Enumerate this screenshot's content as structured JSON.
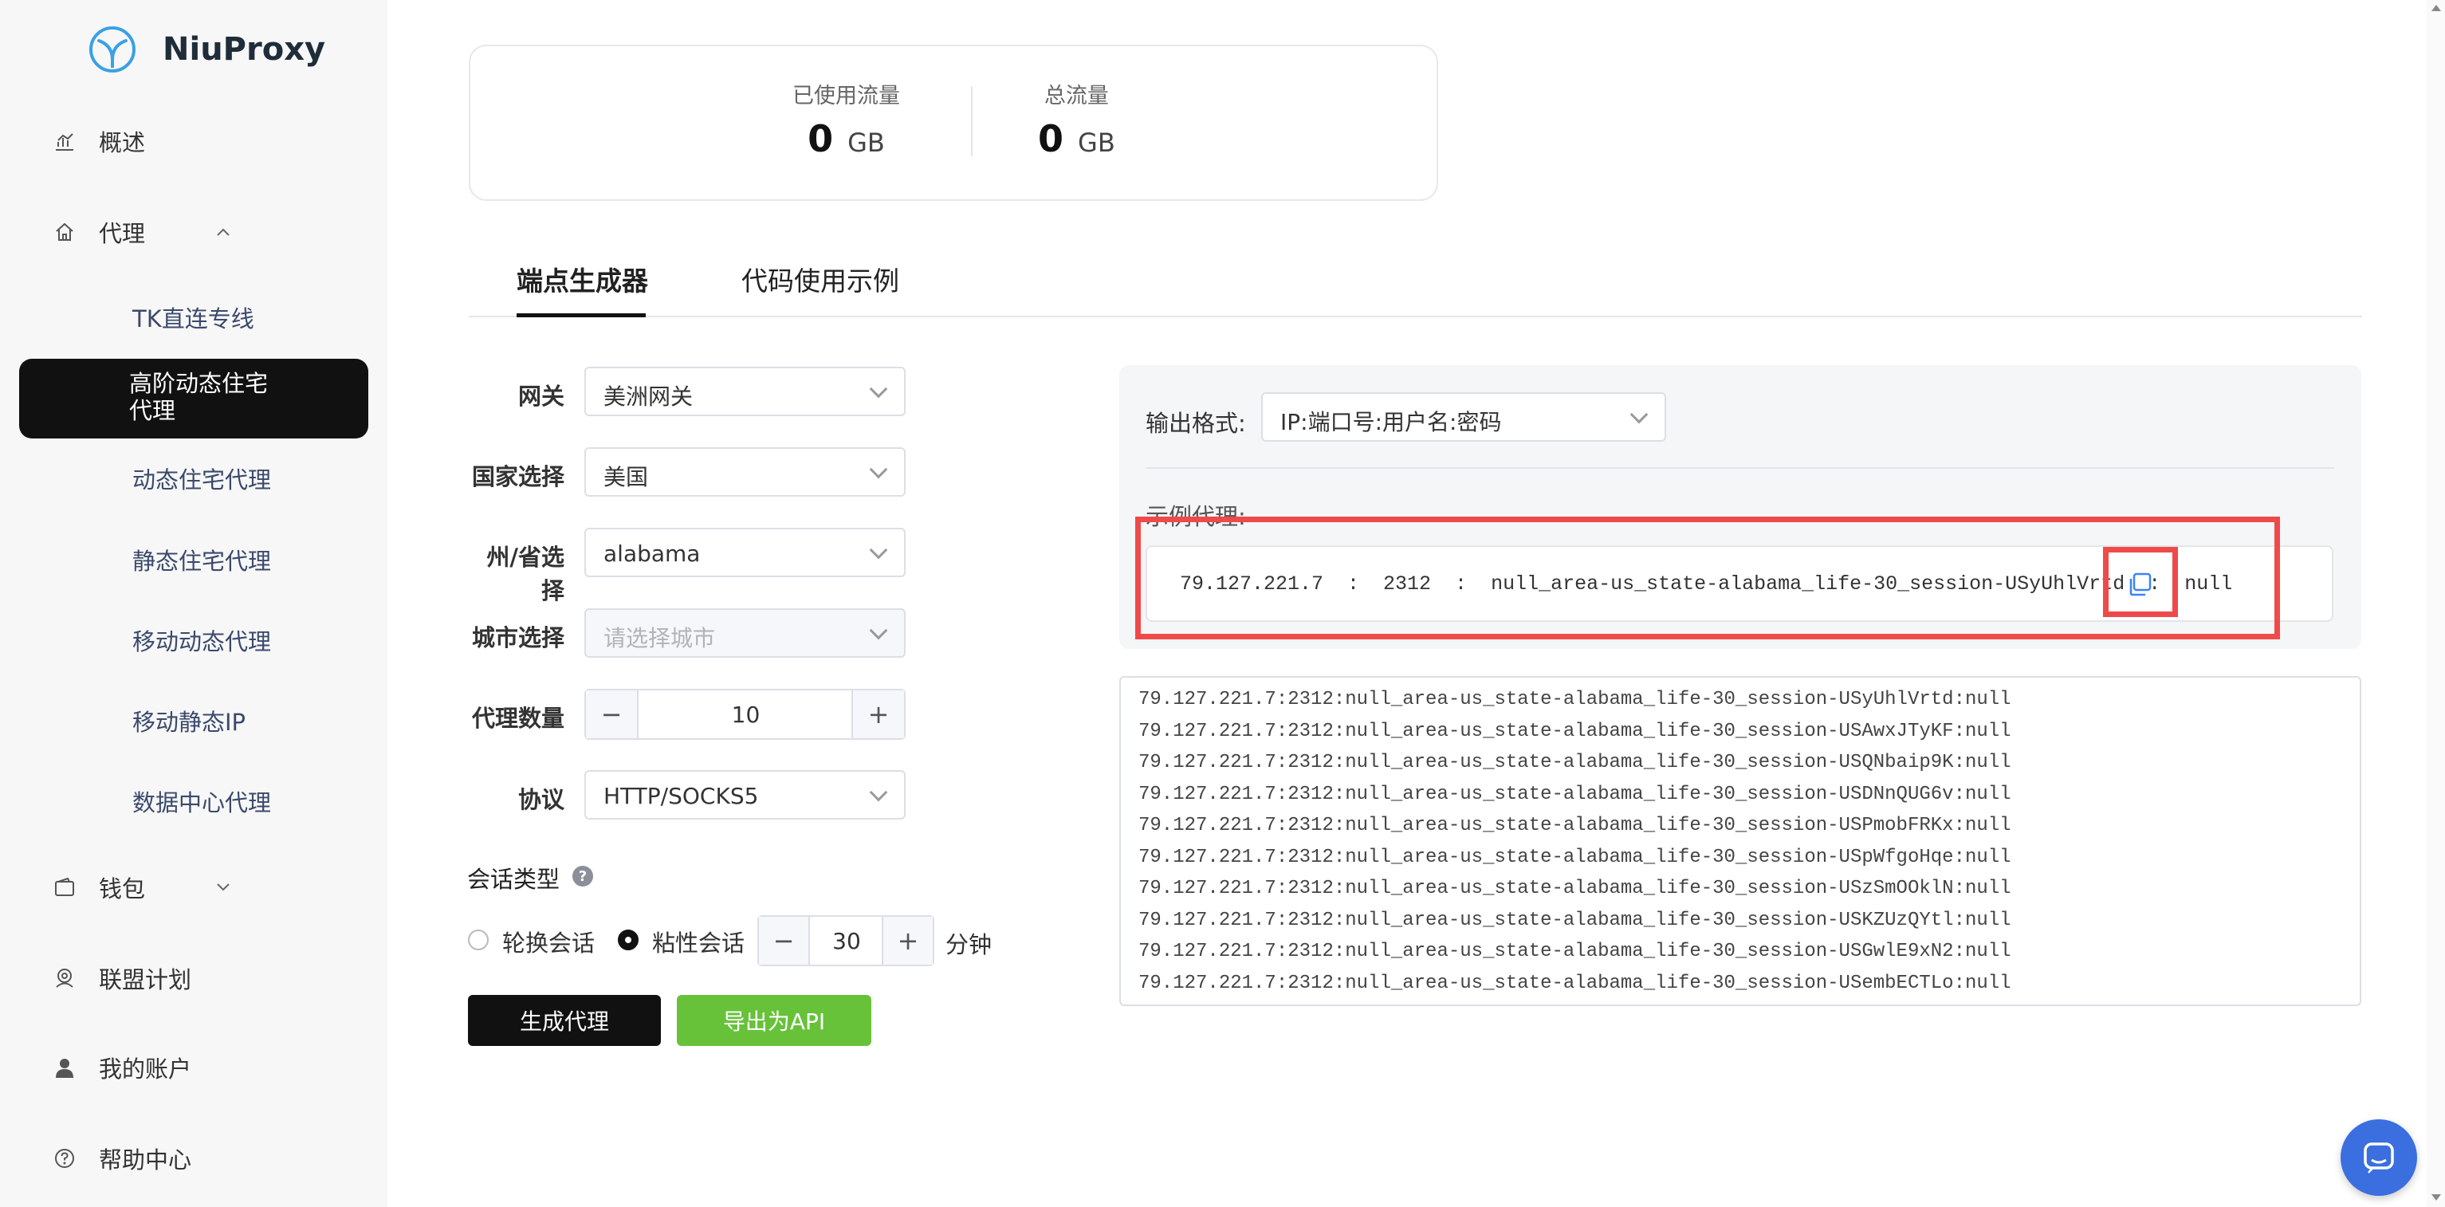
{
  "brand": {
    "name": "NiuProxy"
  },
  "sidebar": {
    "items": [
      {
        "label": "概述",
        "icon": "chart-icon"
      },
      {
        "label": "代理",
        "icon": "home-icon",
        "expanded": true
      },
      {
        "label": "钱包",
        "icon": "wallet-icon",
        "expanded": false
      },
      {
        "label": "联盟计划",
        "icon": "affiliate-icon"
      },
      {
        "label": "我的账户",
        "icon": "user-icon"
      },
      {
        "label": "帮助中心",
        "icon": "help-circle-icon"
      }
    ],
    "proxy_sub": [
      "TK直连专线",
      "高阶动态住宅代理",
      "动态住宅代理",
      "静态住宅代理",
      "移动动态代理",
      "移动静态IP",
      "数据中心代理"
    ],
    "active_sub_line1": "高阶动态住宅",
    "active_sub_line2": "代理"
  },
  "stats": {
    "used_label": "已使用流量",
    "used_value": "0",
    "used_unit": "GB",
    "total_label": "总流量",
    "total_value": "0",
    "total_unit": "GB"
  },
  "tabs": [
    {
      "label": "端点生成器",
      "active": true
    },
    {
      "label": "代码使用示例",
      "active": false
    }
  ],
  "form": {
    "gateway_label": "网关",
    "gateway_value": "美洲网关",
    "country_label": "国家选择",
    "country_value": "美国",
    "state_label": "州/省选择",
    "state_value": "alabama",
    "city_label": "城市选择",
    "city_placeholder": "请选择城市",
    "count_label": "代理数量",
    "count_value": "10",
    "protocol_label": "协议",
    "protocol_value": "HTTP/SOCKS5",
    "session_title": "会话类型",
    "rotate_label": "轮换会话",
    "sticky_label": "粘性会话",
    "sticky_selected": true,
    "sticky_minutes": "30",
    "minutes_unit": "分钟",
    "generate_button": "生成代理",
    "export_button": "导出为API"
  },
  "output": {
    "format_label": "输出格式:",
    "format_value": "IP:端口号:用户名:密码",
    "example_label": "示例代理:",
    "example_proxy": "79.127.221.7  :  2312  :  null_area-us_state-alabama_life-30_session-USyUhlVrtd  :  null",
    "proxies": [
      "79.127.221.7:2312:null_area-us_state-alabama_life-30_session-USyUhlVrtd:null",
      "79.127.221.7:2312:null_area-us_state-alabama_life-30_session-USAwxJTyKF:null",
      "79.127.221.7:2312:null_area-us_state-alabama_life-30_session-USQNbaip9K:null",
      "79.127.221.7:2312:null_area-us_state-alabama_life-30_session-USDNnQUG6v:null",
      "79.127.221.7:2312:null_area-us_state-alabama_life-30_session-USPmobFRKx:null",
      "79.127.221.7:2312:null_area-us_state-alabama_life-30_session-USpWfgoHqe:null",
      "79.127.221.7:2312:null_area-us_state-alabama_life-30_session-USzSmOOklN:null",
      "79.127.221.7:2312:null_area-us_state-alabama_life-30_session-USKZUzQYtl:null",
      "79.127.221.7:2312:null_area-us_state-alabama_life-30_session-USGwlE9xN2:null",
      "79.127.221.7:2312:null_area-us_state-alabama_life-30_session-USembECTLo:null"
    ]
  },
  "colors": {
    "accent": "#111111",
    "export_green": "#67c23a",
    "highlight_red": "#ef4a4a",
    "chat_blue": "#3b6fe0"
  }
}
